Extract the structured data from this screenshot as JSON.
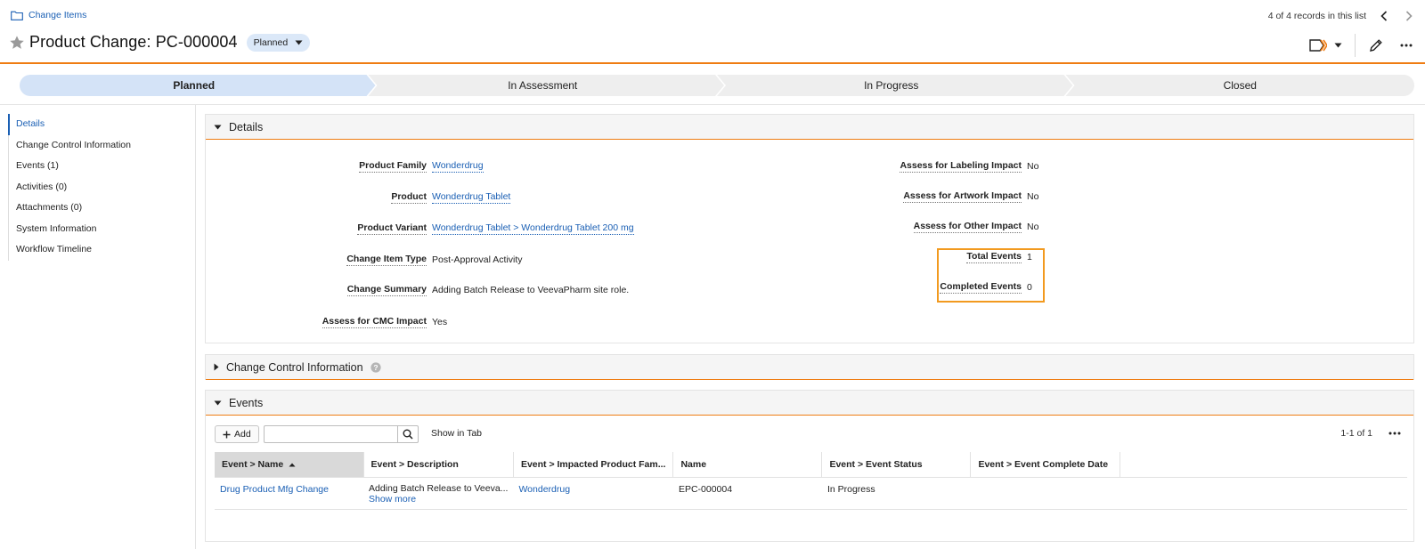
{
  "breadcrumb": {
    "label": "Change Items"
  },
  "record_nav": {
    "text": "4 of 4 records in this list"
  },
  "header": {
    "title": "Product Change: PC-000004",
    "state": "Planned"
  },
  "colors": {
    "accent_orange": "#ef7c12",
    "link_blue": "#1a5fb4",
    "highlight_box": "#f29a1f",
    "stage_active": "#d4e3f7",
    "stage_inactive": "#eeeeee"
  },
  "lifecycle": {
    "stages": [
      {
        "label": "Planned",
        "active": true
      },
      {
        "label": "In Assessment",
        "active": false
      },
      {
        "label": "In Progress",
        "active": false
      },
      {
        "label": "Closed",
        "active": false
      }
    ]
  },
  "left_nav": {
    "items": [
      {
        "label": "Details",
        "active": true
      },
      {
        "label": "Change Control Information"
      },
      {
        "label": "Events (1)"
      },
      {
        "label": "Activities (0)"
      },
      {
        "label": "Attachments (0)"
      },
      {
        "label": "System Information"
      },
      {
        "label": "Workflow Timeline"
      }
    ]
  },
  "details": {
    "title": "Details",
    "left_fields": [
      {
        "label": "Product Family",
        "value": "Wonderdrug",
        "link": true
      },
      {
        "label": "Product",
        "value": "Wonderdrug Tablet",
        "link": true
      },
      {
        "label": "Product Variant",
        "value": "Wonderdrug Tablet > Wonderdrug Tablet 200 mg",
        "link": true
      },
      {
        "label": "Change Item Type",
        "value": "Post-Approval Activity",
        "link": false
      },
      {
        "label": "Change Summary",
        "value": "Adding Batch Release to VeevaPharm site role.",
        "link": false
      },
      {
        "label": "Assess for CMC Impact",
        "value": "Yes",
        "link": false
      }
    ],
    "right_fields": [
      {
        "label": "Assess for Labeling Impact",
        "value": "No"
      },
      {
        "label": "Assess for Artwork Impact",
        "value": "No"
      },
      {
        "label": "Assess for Other Impact",
        "value": "No"
      },
      {
        "label": "Total Events",
        "value": "1"
      },
      {
        "label": "Completed Events",
        "value": "0"
      }
    ]
  },
  "change_control": {
    "title": "Change Control Information"
  },
  "events": {
    "title": "Events",
    "add_label": "Add",
    "search_placeholder": "",
    "show_in_tab": "Show in Tab",
    "pager": "1-1 of 1",
    "columns": [
      "Event > Name",
      "Event > Description",
      "Event > Impacted Product Fam...",
      "Name",
      "Event > Event Status",
      "Event > Event Complete Date"
    ],
    "rows": [
      {
        "name": "Drug Product Mfg Change",
        "description": "Adding Batch Release to Veeva...",
        "show_more": "Show more",
        "product_family": "Wonderdrug",
        "record_name": "EPC-000004",
        "status": "In Progress",
        "complete_date": ""
      }
    ]
  }
}
